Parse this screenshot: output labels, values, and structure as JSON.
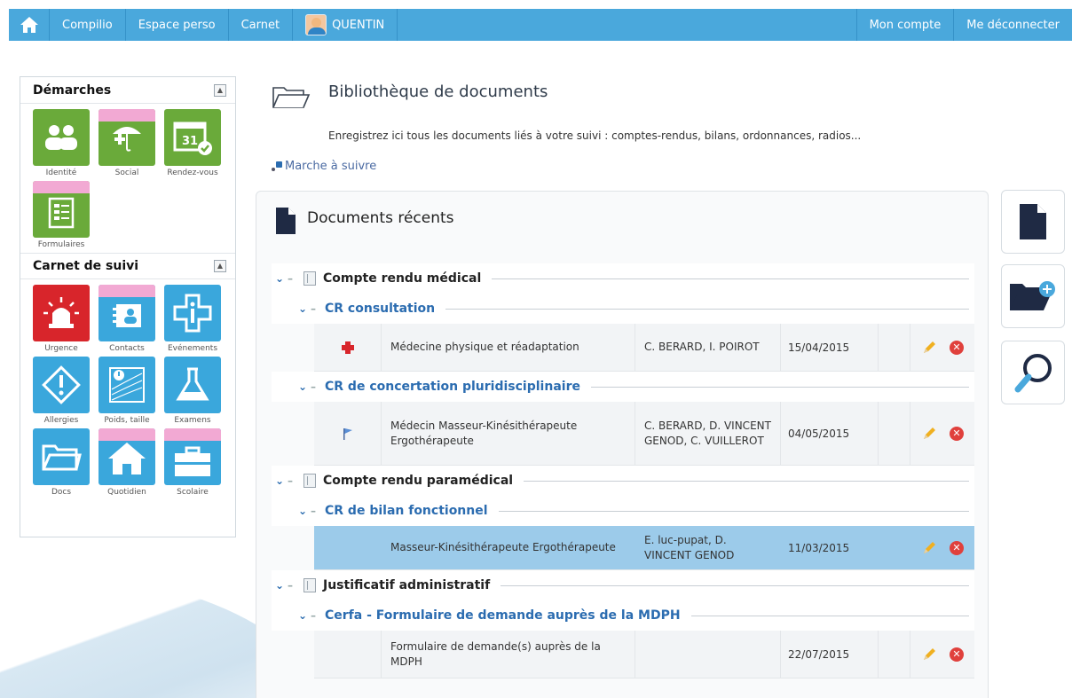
{
  "nav": {
    "home_icon": "home-icon",
    "items": [
      "Compilio",
      "Espace perso",
      "Carnet"
    ],
    "user": "QUENTIN",
    "right_items": [
      "Mon compte",
      "Me déconnecter"
    ]
  },
  "sidebar": {
    "demarches": {
      "title": "Démarches",
      "tiles": [
        {
          "label": "Identité",
          "icon": "identity-icon"
        },
        {
          "label": "Social",
          "icon": "social-icon"
        },
        {
          "label": "Rendez-vous",
          "icon": "calendar-icon",
          "day": "31"
        },
        {
          "label": "Formulaires",
          "icon": "forms-icon"
        }
      ]
    },
    "carnet": {
      "title": "Carnet de suivi",
      "tiles": [
        {
          "label": "Urgence",
          "icon": "alarm-icon"
        },
        {
          "label": "Contacts",
          "icon": "contacts-icon"
        },
        {
          "label": "Evénements",
          "icon": "info-icon"
        },
        {
          "label": "Allergies",
          "icon": "warning-icon"
        },
        {
          "label": "Poids, taille",
          "icon": "scale-icon"
        },
        {
          "label": "Examens",
          "icon": "flask-icon"
        },
        {
          "label": "Docs",
          "icon": "folder-icon"
        },
        {
          "label": "Quotidien",
          "icon": "house-icon"
        },
        {
          "label": "Scolaire",
          "icon": "briefcase-icon"
        }
      ]
    }
  },
  "main": {
    "title": "Bibliothèque de documents",
    "description": "Enregistrez ici tous les documents liés à votre suivi : comptes-rendus, bilans, ordonnances, radios...",
    "howto": "Marche à suivre",
    "recent_title": "Documents récents",
    "categories": [
      {
        "name": "Compte rendu médical",
        "subcategories": [
          {
            "name": "CR consultation",
            "documents": [
              {
                "icon": "red-cross-icon",
                "type": "Médecine physique et réadaptation",
                "authors": "C. BERARD, I. POIROT",
                "date": "15/04/2015",
                "selected": false
              }
            ]
          },
          {
            "name": "CR de concertation pluridisciplinaire",
            "documents": [
              {
                "icon": "flag-icon",
                "type": "Médecin Masseur-Kinésithérapeute Ergothérapeute",
                "authors": "C. BERARD, D. VINCENT GENOD, C. VUILLEROT",
                "date": "04/05/2015",
                "selected": false
              }
            ]
          }
        ]
      },
      {
        "name": "Compte rendu paramédical",
        "subcategories": [
          {
            "name": "CR de bilan fonctionnel",
            "documents": [
              {
                "icon": "",
                "type": "Masseur-Kinésithérapeute Ergothérapeute",
                "authors": "E. luc-pupat, D. VINCENT GENOD",
                "date": "11/03/2015",
                "selected": true
              }
            ]
          }
        ]
      },
      {
        "name": "Justificatif administratif",
        "subcategories": [
          {
            "name": "Cerfa - Formulaire de demande auprès de la MDPH",
            "documents": [
              {
                "icon": "",
                "type": "Formulaire de demande(s) auprès de la MDPH",
                "authors": "",
                "date": "22/07/2015",
                "selected": false
              }
            ]
          }
        ]
      }
    ]
  },
  "tools": [
    "new-document-icon",
    "add-folder-icon",
    "search-icon"
  ],
  "colors": {
    "accent": "#4aa8dc",
    "green": "#6aaa3a",
    "red": "#d8252b",
    "blue": "#3aa7dc",
    "pink": "#f2a9d3",
    "selected_row": "#9ccbea"
  }
}
